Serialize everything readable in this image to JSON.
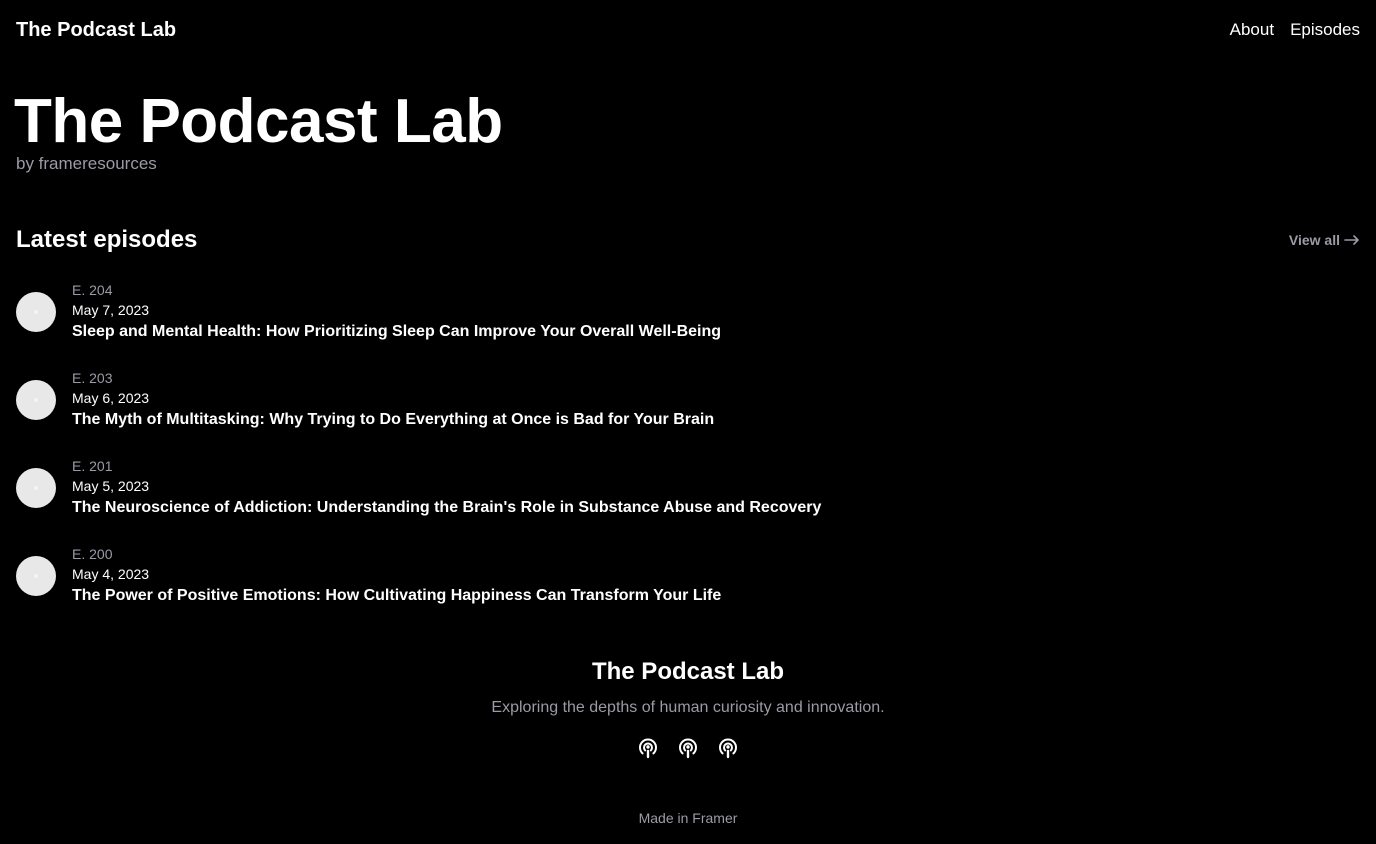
{
  "nav": {
    "logo": "The Podcast Lab",
    "links": [
      "About",
      "Episodes"
    ]
  },
  "hero": {
    "title": "The Podcast Lab",
    "byline": "by frameresources"
  },
  "latest": {
    "heading": "Latest episodes",
    "view_all": "View all",
    "view_all_icon": "arrow-right-icon"
  },
  "episodes": [
    {
      "number": "E. 204",
      "date": "May 7, 2023",
      "title": "Sleep and Mental Health: How Prioritizing Sleep Can Improve Your Overall Well-Being"
    },
    {
      "number": "E. 203",
      "date": "May 6, 2023",
      "title": "The Myth of Multitasking: Why Trying to Do Everything at Once is Bad for Your Brain"
    },
    {
      "number": "E. 201",
      "date": "May 5, 2023",
      "title": "The Neuroscience of Addiction: Understanding the Brain's Role in Substance Abuse and Recovery"
    },
    {
      "number": "E. 200",
      "date": "May 4, 2023",
      "title": "The Power of Positive Emotions: How Cultivating Happiness Can Transform Your Life"
    }
  ],
  "footer": {
    "title": "The Podcast Lab",
    "tagline": "Exploring the depths of human curiosity and innovation.",
    "icons": [
      "podcast-icon",
      "podcast-icon",
      "podcast-icon"
    ],
    "made_in": "Made in Framer"
  },
  "colors": {
    "background": "#000000",
    "text": "#ffffff",
    "muted": "#9a9ba6",
    "thumbnail": "#e8e8e8"
  }
}
